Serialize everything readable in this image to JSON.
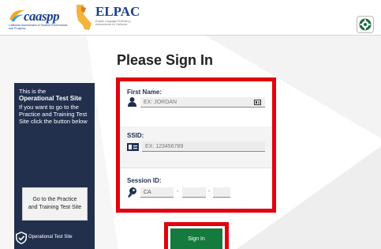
{
  "header": {
    "caaspp_logo": {
      "name": "caaspp",
      "subtitle": "California Assessment of Student Performance and Progress"
    },
    "elpac_logo": {
      "name": "ELPAC",
      "subtitle": "English Language Proficiency Assessments for California"
    },
    "settings_icon": "gear-icon"
  },
  "page": {
    "title": "Please Sign In"
  },
  "form": {
    "first_name": {
      "label": "First Name:",
      "placeholder": "EX: JORDAN",
      "icon": "user-icon",
      "aux_icon": "id-card-icon"
    },
    "ssid": {
      "label": "SSID:",
      "placeholder": "EX: 123456789",
      "icon": "id-card-icon"
    },
    "session_id": {
      "label": "Session ID:",
      "prefix": "CA",
      "separator": "-",
      "icon": "key-icon"
    }
  },
  "side_panel": {
    "line1": "This is the",
    "line2": "Operational Test Site",
    "line3": "If you want to go to the Practice and Training Test Site click the button below",
    "button_label": "Go to the Practice and Training Test Site"
  },
  "footer": {
    "operational_label": "Operational Test Site",
    "signin_label": "Sign In"
  },
  "colors": {
    "navy": "#22304e",
    "red_highlight": "#e3000f",
    "green": "#147a3d",
    "brand_blue": "#1b3f8f"
  }
}
